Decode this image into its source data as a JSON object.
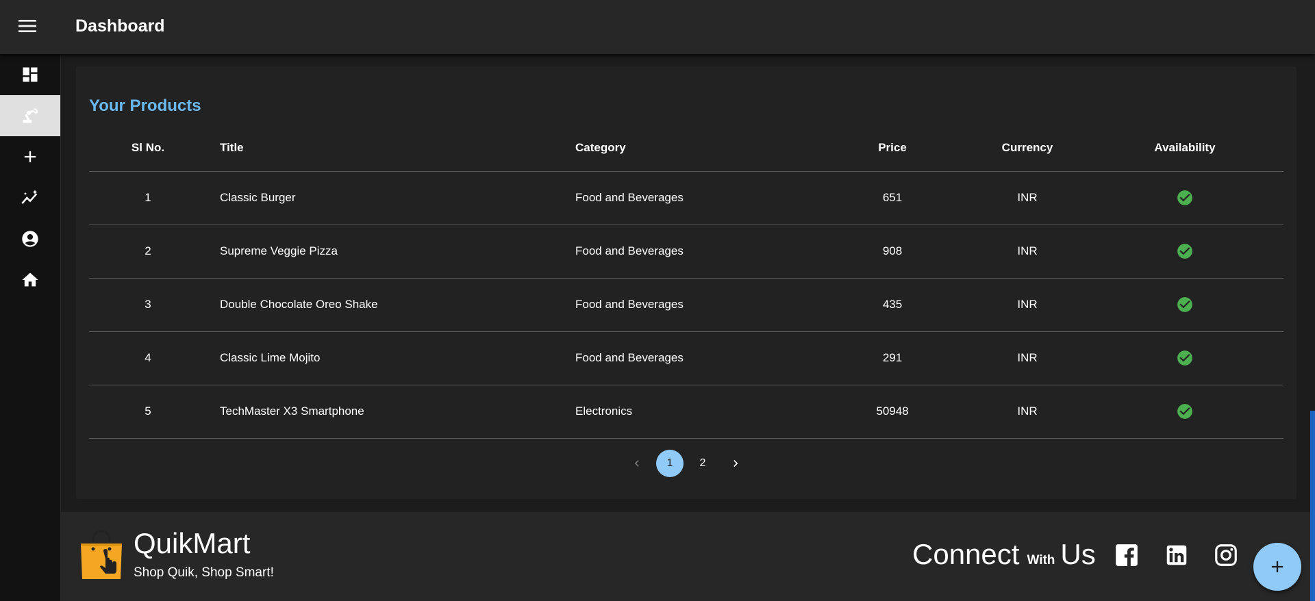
{
  "app": {
    "title": "Dashboard"
  },
  "sidebar": {
    "items": [
      {
        "icon": "dashboard-icon",
        "active": false
      },
      {
        "icon": "products-robot-arm-icon",
        "active": true
      },
      {
        "icon": "add-icon",
        "active": false
      },
      {
        "icon": "analytics-icon",
        "active": false
      },
      {
        "icon": "account-circle-icon",
        "active": false
      },
      {
        "icon": "home-icon",
        "active": false
      }
    ]
  },
  "products": {
    "heading": "Your Products",
    "columns": {
      "sl": "Sl No.",
      "title": "Title",
      "category": "Category",
      "price": "Price",
      "currency": "Currency",
      "availability": "Availability"
    },
    "rows": [
      {
        "sl": "1",
        "title": "Classic Burger",
        "category": "Food and Beverages",
        "price": "651",
        "currency": "INR",
        "available": true
      },
      {
        "sl": "2",
        "title": "Supreme Veggie Pizza",
        "category": "Food and Beverages",
        "price": "908",
        "currency": "INR",
        "available": true
      },
      {
        "sl": "3",
        "title": "Double Chocolate Oreo Shake",
        "category": "Food and Beverages",
        "price": "435",
        "currency": "INR",
        "available": true
      },
      {
        "sl": "4",
        "title": "Classic Lime Mojito",
        "category": "Food and Beverages",
        "price": "291",
        "currency": "INR",
        "available": true
      },
      {
        "sl": "5",
        "title": "TechMaster X3 Smartphone",
        "category": "Electronics",
        "price": "50948",
        "currency": "INR",
        "available": true
      }
    ],
    "pagination": {
      "pages": [
        "1",
        "2"
      ],
      "current": "1"
    }
  },
  "footer": {
    "brand": "QuikMart",
    "tagline": "Shop Quik, Shop Smart!",
    "connect_1": "Connect",
    "connect_with": "With",
    "connect_2": "Us",
    "social": [
      "facebook-icon",
      "linkedin-icon",
      "instagram-icon"
    ]
  },
  "colors": {
    "accent": "#90caf9",
    "heading": "#6ab8f0",
    "check": "#4caf50",
    "logo": "#f5a623"
  }
}
